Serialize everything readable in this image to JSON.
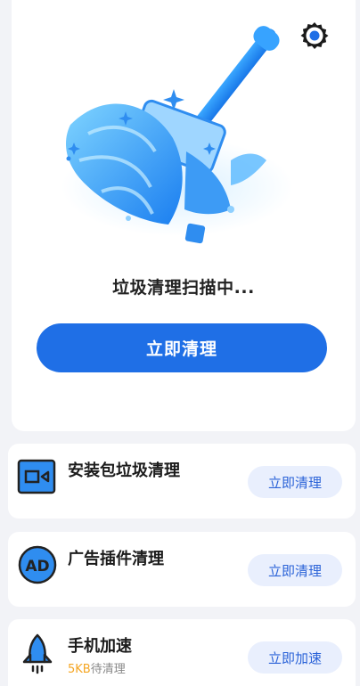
{
  "header": {
    "scan_status": "垃圾清理扫描中...",
    "clean_button": "立即清理",
    "settings_icon": "gear-icon",
    "illustration": "broom-cleaning-illustration"
  },
  "features": [
    {
      "icon": "package-icon",
      "title": "安装包垃圾清理",
      "button": "立即清理"
    },
    {
      "icon": "ad-icon",
      "title": "广告插件清理",
      "button": "立即清理"
    },
    {
      "icon": "rocket-icon",
      "title": "手机加速",
      "subtitle_amount": "5KB",
      "subtitle_suffix": "待清理",
      "button": "立即加速"
    }
  ],
  "colors": {
    "accent": "#1f6fe6",
    "pill_bg": "#e9effd",
    "pill_text": "#2b63d8",
    "warning": "#f5a623",
    "background": "#f2f3f7"
  }
}
